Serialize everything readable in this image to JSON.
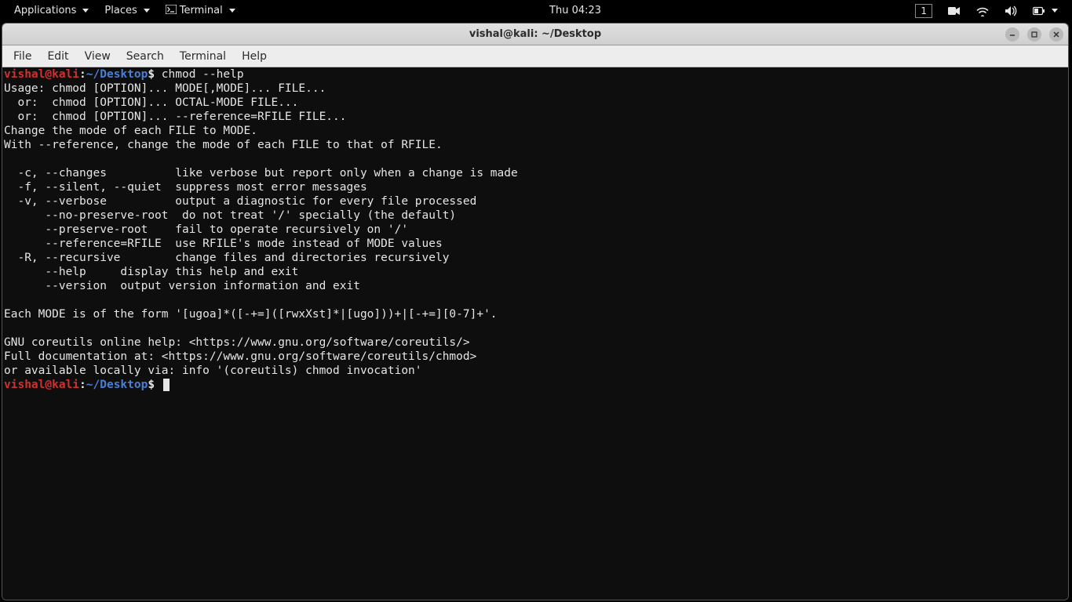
{
  "topbar": {
    "applications": "Applications",
    "places": "Places",
    "terminal": "Terminal",
    "clock": "Thu 04:23",
    "workspace": "1"
  },
  "window": {
    "title": "vishal@kali: ~/Desktop"
  },
  "menubar": {
    "items": [
      "File",
      "Edit",
      "View",
      "Search",
      "Terminal",
      "Help"
    ]
  },
  "prompt": {
    "user_host": "vishal@kali",
    "colon": ":",
    "tilde": "~",
    "slash": "/",
    "dir": "Desktop",
    "dollar": "$"
  },
  "terminal": {
    "command": " chmod --help",
    "output_lines": [
      "Usage: chmod [OPTION]... MODE[,MODE]... FILE...",
      "  or:  chmod [OPTION]... OCTAL-MODE FILE...",
      "  or:  chmod [OPTION]... --reference=RFILE FILE...",
      "Change the mode of each FILE to MODE.",
      "With --reference, change the mode of each FILE to that of RFILE.",
      "",
      "  -c, --changes          like verbose but report only when a change is made",
      "  -f, --silent, --quiet  suppress most error messages",
      "  -v, --verbose          output a diagnostic for every file processed",
      "      --no-preserve-root  do not treat '/' specially (the default)",
      "      --preserve-root    fail to operate recursively on '/'",
      "      --reference=RFILE  use RFILE's mode instead of MODE values",
      "  -R, --recursive        change files and directories recursively",
      "      --help     display this help and exit",
      "      --version  output version information and exit",
      "",
      "Each MODE is of the form '[ugoa]*([-+=]([rwxXst]*|[ugo]))+|[-+=][0-7]+'.",
      "",
      "GNU coreutils online help: <https://www.gnu.org/software/coreutils/>",
      "Full documentation at: <https://www.gnu.org/software/coreutils/chmod>",
      "or available locally via: info '(coreutils) chmod invocation'"
    ]
  }
}
